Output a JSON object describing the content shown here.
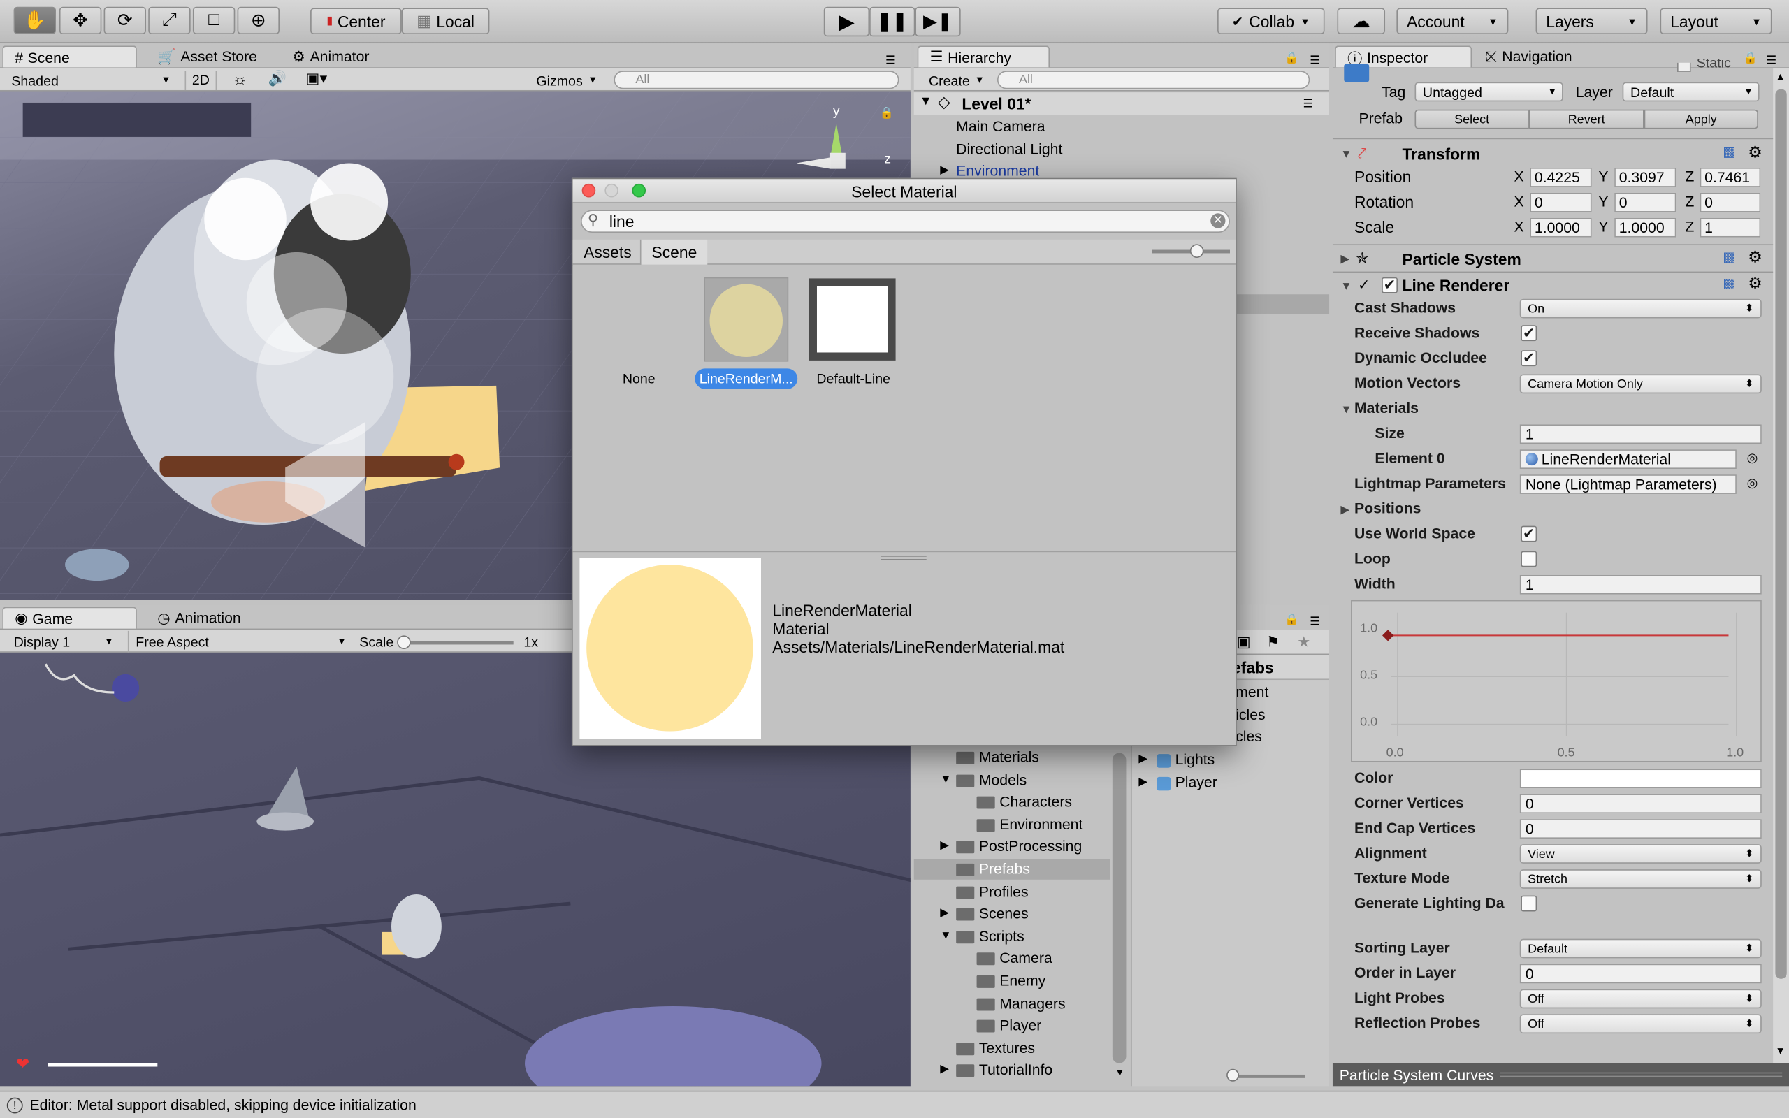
{
  "toolbar": {
    "pivot": "Center",
    "space": "Local",
    "collab": "Collab",
    "account": "Account",
    "layers": "Layers",
    "layout": "Layout"
  },
  "scene": {
    "tab_scene": "Scene",
    "tab_asset_store": "Asset Store",
    "tab_animator": "Animator",
    "shading": "Shaded",
    "mode_2d": "2D",
    "gizmos": "Gizmos",
    "search_placeholder": "All",
    "axis_y": "y",
    "axis_z": "z"
  },
  "game": {
    "tab_game": "Game",
    "tab_animation": "Animation",
    "display": "Display 1",
    "aspect": "Free Aspect",
    "scale_label": "Scale",
    "scale_value": "1x"
  },
  "hierarchy": {
    "tab": "Hierarchy",
    "create": "Create",
    "search_placeholder": "All",
    "scene": "Level 01*",
    "items": [
      "Main Camera",
      "Directional Light",
      "Environment"
    ]
  },
  "project": {
    "breadcrumb": "Prefabs",
    "partial_items": [
      "ment",
      "icles",
      "cles"
    ],
    "assets": [
      "Lights",
      "Player"
    ],
    "folders": [
      {
        "name": "Materials",
        "indent": 0,
        "expander": ""
      },
      {
        "name": "Models",
        "indent": 0,
        "expander": "▼"
      },
      {
        "name": "Characters",
        "indent": 1,
        "expander": ""
      },
      {
        "name": "Environment",
        "indent": 1,
        "expander": ""
      },
      {
        "name": "PostProcessing",
        "indent": 0,
        "expander": "▶"
      },
      {
        "name": "Prefabs",
        "indent": 0,
        "expander": ""
      },
      {
        "name": "Profiles",
        "indent": 0,
        "expander": ""
      },
      {
        "name": "Scenes",
        "indent": 0,
        "expander": "▶"
      },
      {
        "name": "Scripts",
        "indent": 0,
        "expander": "▼"
      },
      {
        "name": "Camera",
        "indent": 1,
        "expander": ""
      },
      {
        "name": "Enemy",
        "indent": 1,
        "expander": ""
      },
      {
        "name": "Managers",
        "indent": 1,
        "expander": ""
      },
      {
        "name": "Player",
        "indent": 1,
        "expander": ""
      },
      {
        "name": "Textures",
        "indent": 0,
        "expander": ""
      },
      {
        "name": "TutorialInfo",
        "indent": 0,
        "expander": "▶"
      }
    ]
  },
  "dialog": {
    "title": "Select Material",
    "search_value": "line",
    "tab_assets": "Assets",
    "tab_scene": "Scene",
    "items": [
      {
        "label": "None"
      },
      {
        "label": "LineRenderM..."
      },
      {
        "label": "Default-Line"
      }
    ],
    "preview_name": "LineRenderMaterial",
    "preview_type": "Material",
    "preview_path": "Assets/Materials/LineRenderMaterial.mat",
    "preview_color": "#fee59e"
  },
  "inspector": {
    "tab_inspector": "Inspector",
    "tab_navigation": "Navigation",
    "static_label": "Static",
    "tag_label": "Tag",
    "tag_value": "Untagged",
    "layer_label": "Layer",
    "layer_value": "Default",
    "prefab_label": "Prefab",
    "prefab_select": "Select",
    "prefab_revert": "Revert",
    "prefab_apply": "Apply",
    "transform": {
      "title": "Transform",
      "position_label": "Position",
      "rotation_label": "Rotation",
      "scale_label": "Scale",
      "position": {
        "x": "0.4225",
        "y": "0.3097",
        "z": "0.7461"
      },
      "rotation": {
        "x": "0",
        "y": "0",
        "z": "0"
      },
      "scale": {
        "x": "1.0000",
        "y": "1.0000",
        "z": "1"
      }
    },
    "particle_system": "Particle System",
    "line_renderer": {
      "title": "Line Renderer",
      "cast_shadows_label": "Cast Shadows",
      "cast_shadows": "On",
      "receive_shadows_label": "Receive Shadows",
      "dynamic_occludee_label": "Dynamic Occludee",
      "motion_vectors_label": "Motion Vectors",
      "motion_vectors": "Camera Motion Only",
      "materials_label": "Materials",
      "size_label": "Size",
      "size": "1",
      "element0_label": "Element 0",
      "element0": "LineRenderMaterial",
      "lightmap_label": "Lightmap Parameters",
      "lightmap": "None (Lightmap Parameters)",
      "positions_label": "Positions",
      "use_world_space_label": "Use World Space",
      "loop_label": "Loop",
      "width_label": "Width",
      "width": "1",
      "curve": {
        "y_ticks": [
          "1.0",
          "0.5",
          "0.0"
        ],
        "x_ticks": [
          "0.0",
          "0.5",
          "1.0"
        ],
        "key_value": 1.0,
        "line_color": "#c8383a"
      },
      "color_label": "Color",
      "color": "#ffffff",
      "corner_vertices_label": "Corner Vertices",
      "corner_vertices": "0",
      "end_cap_vertices_label": "End Cap Vertices",
      "end_cap_vertices": "0",
      "alignment_label": "Alignment",
      "alignment": "View",
      "texture_mode_label": "Texture Mode",
      "texture_mode": "Stretch",
      "generate_lighting_label": "Generate Lighting Da",
      "sorting_layer_label": "Sorting Layer",
      "sorting_layer": "Default",
      "order_in_layer_label": "Order in Layer",
      "order_in_layer": "0",
      "light_probes_label": "Light Probes",
      "light_probes": "Off",
      "reflection_probes_label": "Reflection Probes",
      "reflection_probes": "Off"
    },
    "curves_bar": "Particle System Curves"
  },
  "status": {
    "message": "Editor: Metal support disabled, skipping device initialization"
  }
}
